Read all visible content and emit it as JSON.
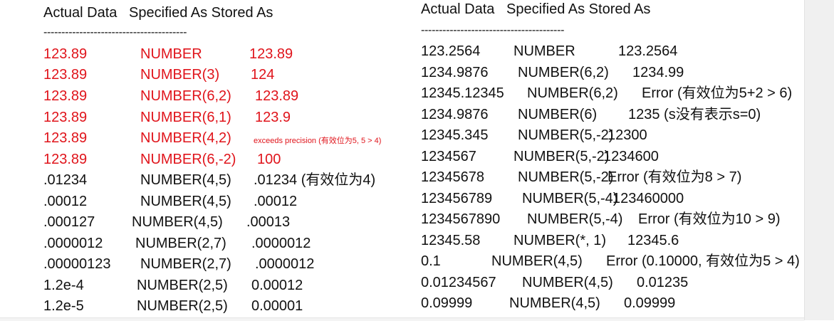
{
  "left": {
    "header": "Actual Data   Specified As Stored As",
    "rule": "----------------------------------------",
    "rows": [
      {
        "actual": "123.89",
        "spec": "NUMBER",
        "stored": "123.89"
      },
      {
        "actual": "123.89",
        "spec": "NUMBER(3)",
        "stored": "124"
      },
      {
        "actual": "123.89",
        "spec": "NUMBER(6,2)",
        "stored": "123.89"
      },
      {
        "actual": "123.89",
        "spec": "NUMBER(6,1)",
        "stored": "123.9"
      },
      {
        "actual": "123.89",
        "spec": "NUMBER(4,2)",
        "stored": "exceeds precision (有效位为5, 5 > 4)"
      },
      {
        "actual": "123.89",
        "spec": "NUMBER(6,-2)",
        "stored": "100"
      },
      {
        "actual": ".01234",
        "spec": "NUMBER(4,5)",
        "stored": ".01234 (有效位为4)"
      },
      {
        "actual": ".00012",
        "spec": "NUMBER(4,5)",
        "stored": ".00012"
      },
      {
        "actual": ".000127",
        "spec": "NUMBER(4,5)",
        "stored": ".00013"
      },
      {
        "actual": ".0000012",
        "spec": "NUMBER(2,7)",
        "stored": ".0000012"
      },
      {
        "actual": ".00000123",
        "spec": "NUMBER(2,7)",
        "stored": ".0000012"
      },
      {
        "actual": "1.2e-4",
        "spec": "NUMBER(2,5)",
        "stored": "0.00012"
      },
      {
        "actual": "1.2e-5",
        "spec": "NUMBER(2,5)",
        "stored": "0.00001"
      }
    ]
  },
  "right": {
    "header": "Actual Data   Specified As Stored As",
    "rule": "----------------------------------------",
    "rows": [
      {
        "actual": "123.2564",
        "spec": "NUMBER",
        "stored": "123.2564"
      },
      {
        "actual": "1234.9876",
        "spec": "NUMBER(6,2)",
        "stored": "1234.99"
      },
      {
        "actual": "12345.12345",
        "spec": "NUMBER(6,2)",
        "stored": "Error (有效位为5+2 > 6)"
      },
      {
        "actual": "1234.9876",
        "spec": "NUMBER(6)",
        "stored": "1235 (s没有表示s=0)"
      },
      {
        "actual": "12345.345",
        "spec": "NUMBER(5,-2)",
        "stored": "12300"
      },
      {
        "actual": "1234567",
        "spec": "NUMBER(5,-2)",
        "stored": "1234600"
      },
      {
        "actual": "12345678",
        "spec": "NUMBER(5,-2)",
        "stored": "Error (有效位为8 > 7)"
      },
      {
        "actual": "123456789",
        "spec": "NUMBER(5,-4)",
        "stored": "123460000"
      },
      {
        "actual": "1234567890",
        "spec": "NUMBER(5,-4)",
        "stored": "Error (有效位为10 > 9)"
      },
      {
        "actual": "12345.58",
        "spec": "NUMBER(*, 1)",
        "stored": "12345.6"
      },
      {
        "actual": "0.1",
        "spec": "NUMBER(4,5)",
        "stored": "Error (0.10000, 有效位为5 > 4)"
      },
      {
        "actual": "0.01234567",
        "spec": "NUMBER(4,5)",
        "stored": "0.01235"
      },
      {
        "actual": "0.09999",
        "spec": "NUMBER(4,5)",
        "stored": "0.09999"
      }
    ]
  },
  "colors": {
    "highlight": "#e0141b",
    "text": "#111111"
  }
}
